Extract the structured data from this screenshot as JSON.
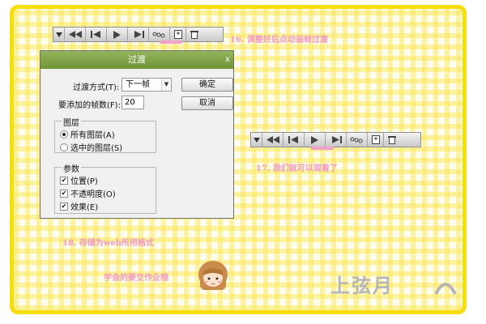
{
  "toolbar_icons": [
    "dropdown-arrow-icon",
    "first-frame-icon",
    "previous-frame-icon",
    "play-icon",
    "next-frame-icon",
    "tween-icon",
    "new-frame-icon",
    "delete-frame-icon"
  ],
  "captions": {
    "step16": "16. 调整好后点动画帧过渡",
    "step17": "17. 我们就可以观看了",
    "step18": "18. 存储为web所用格式",
    "homework": "学会的要交作业哦"
  },
  "dialog": {
    "title": "过渡",
    "close": "x",
    "tween_with_label": "过渡方式(T):",
    "tween_with_value": "下一帧",
    "frames_to_add_label": "要添加的帧数(F):",
    "frames_to_add_value": "20",
    "ok_button": "确定",
    "cancel_button": "取消",
    "layers_group": {
      "title": "图层",
      "all_layers": "所有图层(A)",
      "selected_layers": "选中的图层(S)",
      "selected": "all_layers"
    },
    "params_group": {
      "title": "参数",
      "position": "位置(P)",
      "opacity": "不透明度(O)",
      "effects": "效果(E)",
      "checked": [
        "position",
        "opacity",
        "effects"
      ]
    }
  },
  "colors": {
    "frame_border": "#f7de0f",
    "caption": "#f39ac4",
    "dialog_title_bar": "#7fa346",
    "highlight": "#f2a2c6"
  },
  "watermark": "上弦月"
}
